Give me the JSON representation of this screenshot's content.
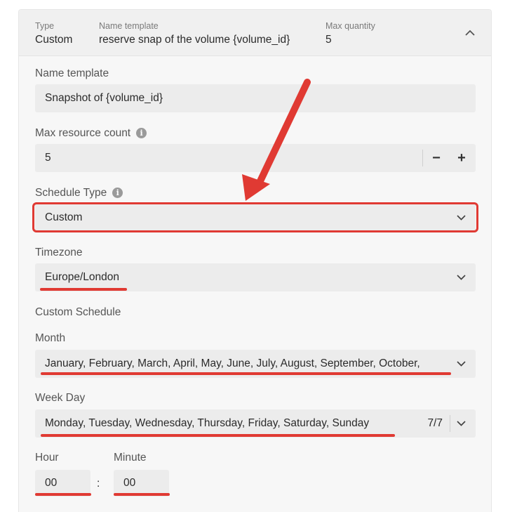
{
  "header": {
    "type_label": "Type",
    "type_value": "Custom",
    "name_template_label": "Name template",
    "name_template_value": "reserve snap of the volume {volume_id}",
    "max_quantity_label": "Max quantity",
    "max_quantity_value": "5"
  },
  "form": {
    "name_template": {
      "label": "Name template",
      "value": "Snapshot of {volume_id}"
    },
    "max_resource_count": {
      "label": "Max resource count",
      "value": "5",
      "minus": "−",
      "plus": "+"
    },
    "schedule_type": {
      "label": "Schedule Type",
      "value": "Custom"
    },
    "timezone": {
      "label": "Timezone",
      "value": "Europe/London"
    },
    "custom_schedule_heading": "Custom Schedule",
    "month": {
      "label": "Month",
      "value": "January, February, March, April, May, June, July, August, September, October,"
    },
    "week_day": {
      "label": "Week Day",
      "value": "Monday, Tuesday, Wednesday, Thursday, Friday, Saturday, Sunday",
      "count": "7/7"
    },
    "hour": {
      "label": "Hour",
      "value": "00"
    },
    "minute": {
      "label": "Minute",
      "value": "00"
    },
    "time_separator": ":"
  },
  "colors": {
    "annotation": "#e03a33",
    "field_bg": "#ececec",
    "panel_bg": "#f7f7f7"
  },
  "icons": [
    "chevron-up-icon",
    "info-icon",
    "chevron-down-icon",
    "minus-icon",
    "plus-icon"
  ]
}
